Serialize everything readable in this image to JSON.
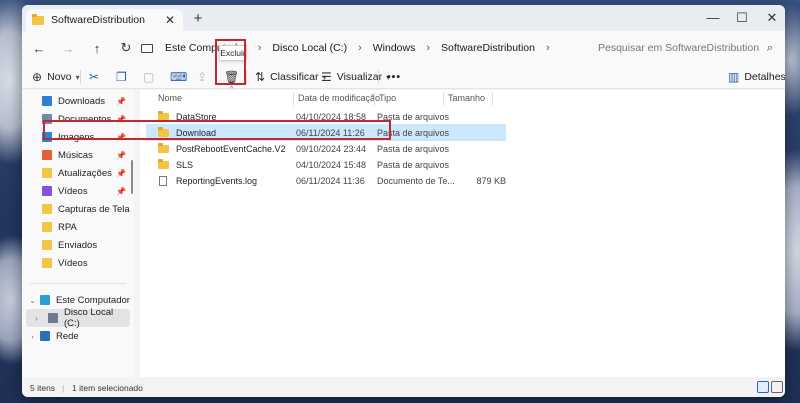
{
  "window": {
    "tab_title": "SoftwareDistribution",
    "new_tab_symbol": "+",
    "close_tab_symbol": "✕",
    "minimize_symbol": "—",
    "maximize_symbol": "☐",
    "close_symbol": "✕"
  },
  "address": {
    "breadcrumbs": [
      "Este Computador",
      "Disco Local (C:)",
      "Windows",
      "SoftwareDistribution"
    ],
    "search_placeholder": "Pesquisar em SoftwareDistribution"
  },
  "toolbar": {
    "new_label": "Novo",
    "sort_label": "Classificar",
    "view_label": "Visualizar",
    "more_label": "•••",
    "details_label": "Detalhes",
    "delete_tooltip": "Excluir"
  },
  "sidebar": {
    "quick_access": [
      {
        "label": "Downloads",
        "icon": "download-icon"
      },
      {
        "label": "Documentos",
        "icon": "document-icon"
      },
      {
        "label": "Imagens",
        "icon": "image-icon"
      },
      {
        "label": "Músicas",
        "icon": "music-icon"
      },
      {
        "label": "Atualizações",
        "icon": "folder-icon"
      },
      {
        "label": "Vídeos",
        "icon": "video-icon"
      },
      {
        "label": "Capturas de Tela",
        "icon": "folder-icon"
      },
      {
        "label": "RPA",
        "icon": "folder-icon"
      },
      {
        "label": "Enviados",
        "icon": "folder-icon"
      },
      {
        "label": "Vídeos",
        "icon": "folder-icon"
      }
    ],
    "this_pc": "Este Computador",
    "local_disk": "Disco Local (C:)",
    "network": "Rede"
  },
  "columns": {
    "name": "Nome",
    "date": "Data de modificação",
    "type": "Tipo",
    "size": "Tamanho"
  },
  "files": [
    {
      "name": "DataStore",
      "date": "04/10/2024 18:58",
      "type": "Pasta de arquivos",
      "size": "",
      "kind": "folder"
    },
    {
      "name": "Download",
      "date": "06/11/2024 11:26",
      "type": "Pasta de arquivos",
      "size": "",
      "kind": "folder",
      "selected": true
    },
    {
      "name": "PostRebootEventCache.V2",
      "date": "09/10/2024 23:44",
      "type": "Pasta de arquivos",
      "size": "",
      "kind": "folder"
    },
    {
      "name": "SLS",
      "date": "04/10/2024 15:48",
      "type": "Pasta de arquivos",
      "size": "",
      "kind": "folder"
    },
    {
      "name": "ReportingEvents.log",
      "date": "06/11/2024 11:36",
      "type": "Documento de Te...",
      "size": "879 KB",
      "kind": "file"
    }
  ],
  "status": {
    "item_count": "5 itens",
    "selection": "1 item selecionado"
  },
  "colors": {
    "selection": "#cce8ff",
    "highlight_box": "#c6262e",
    "folder": "#f4c542"
  }
}
